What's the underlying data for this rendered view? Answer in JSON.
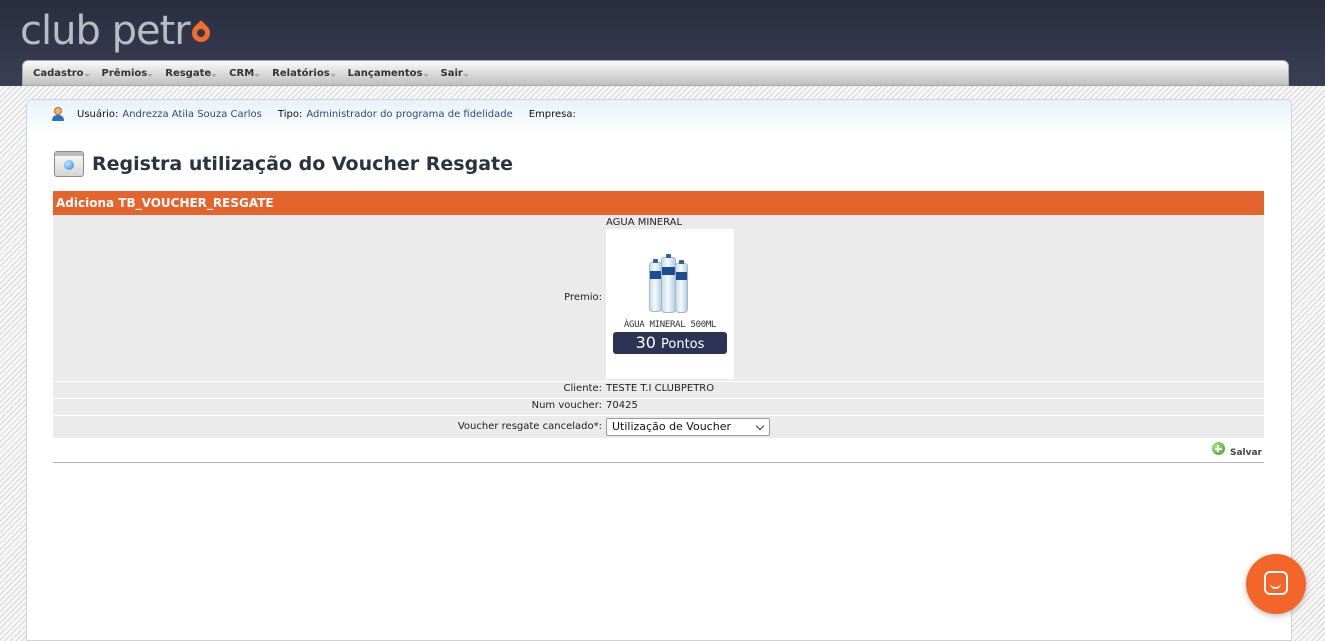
{
  "app": {
    "logo_text": "club petr",
    "brand_color": "#f26c2b"
  },
  "menu": [
    {
      "label": "Cadastro"
    },
    {
      "label": "Prêmios"
    },
    {
      "label": "Resgate"
    },
    {
      "label": "CRM"
    },
    {
      "label": "Relatórios"
    },
    {
      "label": "Lançamentos"
    },
    {
      "label": "Sair"
    }
  ],
  "userbar": {
    "user_label": "Usuário:",
    "user_value": "Andrezza Atila Souza Carlos",
    "type_label": "Tipo:",
    "type_value": "Administrador do programa de fidelidade",
    "company_label": "Empresa:",
    "company_value": ""
  },
  "page": {
    "title": "Registra utilização do Voucher Resgate"
  },
  "form": {
    "header": "Adiciona TB_VOUCHER_RESGATE",
    "header_color": "#e5632c",
    "premio": {
      "label": "Premio:",
      "name": "AGUA MINERAL",
      "image_caption": "ÁGUA MINERAL 500ML",
      "points_value": "30",
      "points_unit": "Pontos"
    },
    "cliente": {
      "label": "Cliente:",
      "value": "TESTE T.I CLUBPETRO"
    },
    "num_voucher": {
      "label": "Num voucher:",
      "value": "70425"
    },
    "cancelado": {
      "label": "Voucher resgate cancelado*:",
      "selected": "Utilização de Voucher"
    },
    "save_label": "Salvar"
  },
  "icons": {
    "user": "user-icon",
    "title": "window-icon",
    "save": "add-circle-icon",
    "chat": "chat-icon"
  }
}
